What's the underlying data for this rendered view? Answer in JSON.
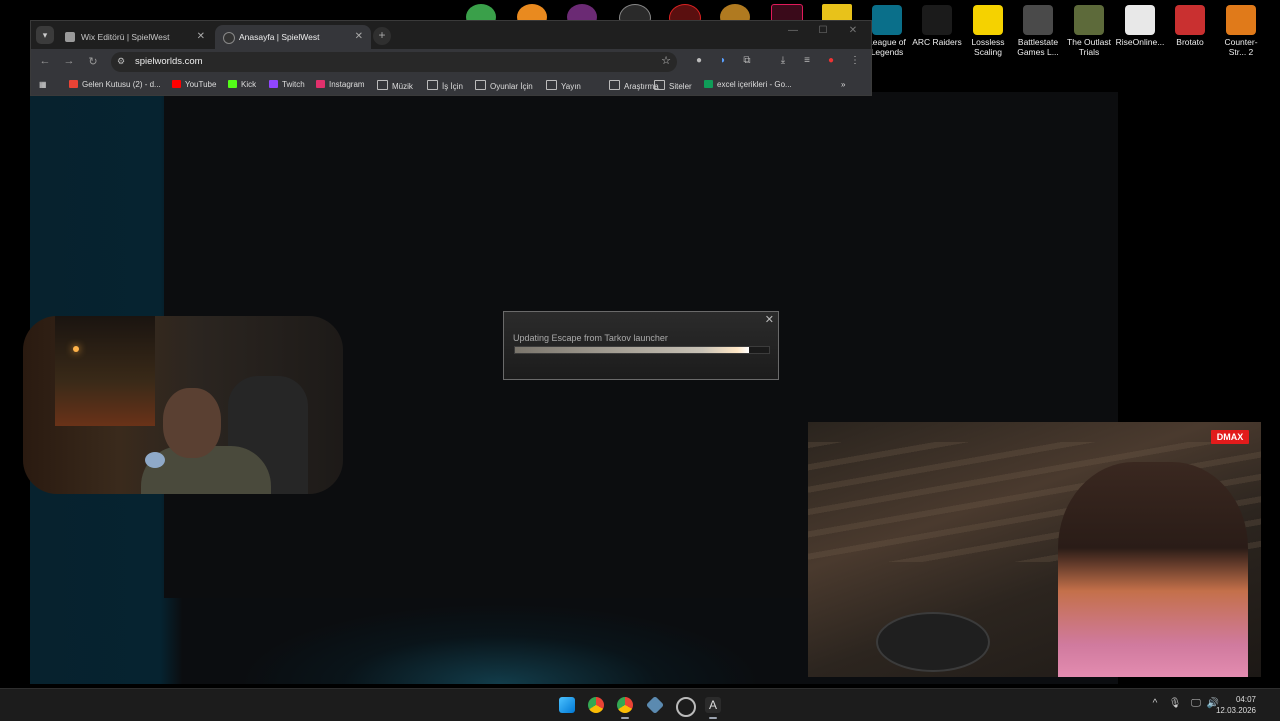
{
  "desktop": {
    "icons": [
      {
        "label": "League of Legends",
        "color": "#0a6f8a"
      },
      {
        "label": "ARC Raiders",
        "color": "#1b1b1b"
      },
      {
        "label": "Lossless Scaling",
        "color": "#f5d200"
      },
      {
        "label": "Battlestate Games L...",
        "color": "#4a4a4a"
      },
      {
        "label": "The Outlast Trials",
        "color": "#5d6a3a"
      },
      {
        "label": "RiseOnline...",
        "color": "#e8e8e8"
      },
      {
        "label": "Brotato",
        "color": "#c93030"
      },
      {
        "label": "Counter-Str... 2",
        "color": "#e07a1a"
      }
    ]
  },
  "browser": {
    "tabs": [
      {
        "title": "Wix Editörü | SpielWest",
        "active": false
      },
      {
        "title": "Anasayfa | SpielWest",
        "active": true
      }
    ],
    "url": "spielworlds.com",
    "bookmarks": [
      {
        "label": "Gelen Kutusu (2) - d...",
        "icon": "gmail-icon",
        "color": "#ea4335"
      },
      {
        "label": "YouTube",
        "icon": "youtube-icon",
        "color": "#ff0000"
      },
      {
        "label": "Kick",
        "icon": "kick-icon",
        "color": "#53fc18"
      },
      {
        "label": "Twitch",
        "icon": "twitch-icon",
        "color": "#9146ff"
      },
      {
        "label": "Instagram",
        "icon": "instagram-icon",
        "color": "#e1306c"
      },
      {
        "label": "Müzik",
        "icon": "folder-icon",
        "color": ""
      },
      {
        "label": "İş İçin",
        "icon": "folder-icon",
        "color": ""
      },
      {
        "label": "Oyunlar İçin",
        "icon": "folder-icon",
        "color": ""
      },
      {
        "label": "Yayın",
        "icon": "folder-icon",
        "color": ""
      },
      {
        "label": "Araştırma",
        "icon": "folder-icon",
        "color": ""
      },
      {
        "label": "Siteler",
        "icon": "folder-icon",
        "color": ""
      },
      {
        "label": "excel içerikleri - Go...",
        "icon": "sheets-icon",
        "color": "#0f9d58"
      }
    ]
  },
  "updater": {
    "message": "Updating Escape from Tarkov launcher",
    "progress_percent": 92
  },
  "video": {
    "logo": "DMAX"
  },
  "taskbar": {
    "time": "04:07",
    "date": "12.03.2026"
  }
}
